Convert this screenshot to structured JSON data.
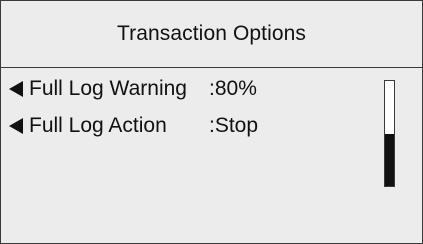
{
  "screen": {
    "title": "Transaction Options"
  },
  "options": [
    {
      "label": "Full Log Warning",
      "separator": ":",
      "value": "80%"
    },
    {
      "label": "Full Log Action",
      "separator": ":",
      "value": "Stop"
    }
  ],
  "scrollbar": {
    "position_fraction": 0.5
  },
  "icons": {
    "option_marker": "left-triangle-icon"
  },
  "colors": {
    "background": "#ececec",
    "text": "#111111",
    "border": "#3a3a3a"
  }
}
